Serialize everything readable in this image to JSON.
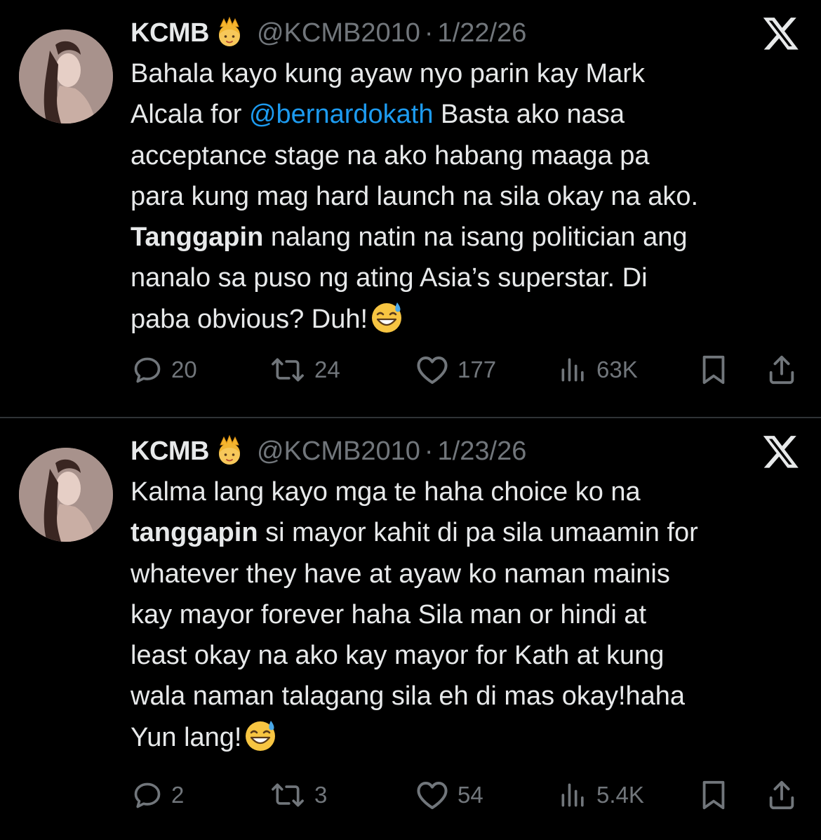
{
  "tweets": [
    {
      "name": "KCMB",
      "handle": "@KCMB2010",
      "separator": "·",
      "date": "1/22/26",
      "lines": [
        [
          {
            "t": "Bahala kayo kung ayaw nyo parin kay Mark"
          }
        ],
        [
          {
            "t": "Alcala for "
          },
          {
            "t": "@bernardokath",
            "k": "mention"
          },
          {
            "t": " Basta ako nasa"
          }
        ],
        [
          {
            "t": "acceptance stage na ako habang maaga pa"
          }
        ],
        [
          {
            "t": "para kung mag hard launch na sila okay na ako."
          }
        ],
        [
          {
            "t": "Tanggapin",
            "k": "strong"
          },
          {
            "t": " nalang natin na isang politician ang"
          }
        ],
        [
          {
            "t": "nanalo sa puso ng ating Asia’s superstar. Di"
          }
        ],
        [
          {
            "t": "paba obvious? Duh!"
          },
          {
            "emoji": "sweat-smile-emoji"
          }
        ]
      ],
      "stats": {
        "replies": "20",
        "reposts": "24",
        "likes": "177",
        "views": "63K"
      }
    },
    {
      "name": "KCMB",
      "handle": "@KCMB2010",
      "separator": "·",
      "date": "1/23/26",
      "lines": [
        [
          {
            "t": "Kalma lang kayo mga te haha choice ko na"
          }
        ],
        [
          {
            "t": "tanggapin",
            "k": "strong"
          },
          {
            "t": " si mayor kahit di pa sila umaamin for"
          }
        ],
        [
          {
            "t": "whatever they have at ayaw ko naman mainis"
          }
        ],
        [
          {
            "t": "kay mayor forever haha  Sila man or hindi at"
          }
        ],
        [
          {
            "t": "least okay na ako kay mayor for Kath at kung"
          }
        ],
        [
          {
            "t": "wala naman talagang sila eh di mas okay!haha"
          }
        ],
        [
          {
            "t": "Yun lang!"
          },
          {
            "emoji": "sweat-smile-emoji"
          }
        ]
      ],
      "stats": {
        "replies": "2",
        "reposts": "3",
        "likes": "54",
        "views": "5.4K"
      }
    }
  ],
  "icons": {
    "badge": "princess-emoji-icon",
    "platform": "x-logo-icon",
    "reply": "reply-icon",
    "repost": "repost-icon",
    "like": "heart-icon",
    "views": "views-icon",
    "bookmark": "bookmark-icon",
    "share": "share-icon"
  },
  "colors": {
    "background": "#000000",
    "text": "#e7e9ea",
    "secondary": "#71767b",
    "mention": "#1d9bf0",
    "divider": "#2f3336"
  }
}
